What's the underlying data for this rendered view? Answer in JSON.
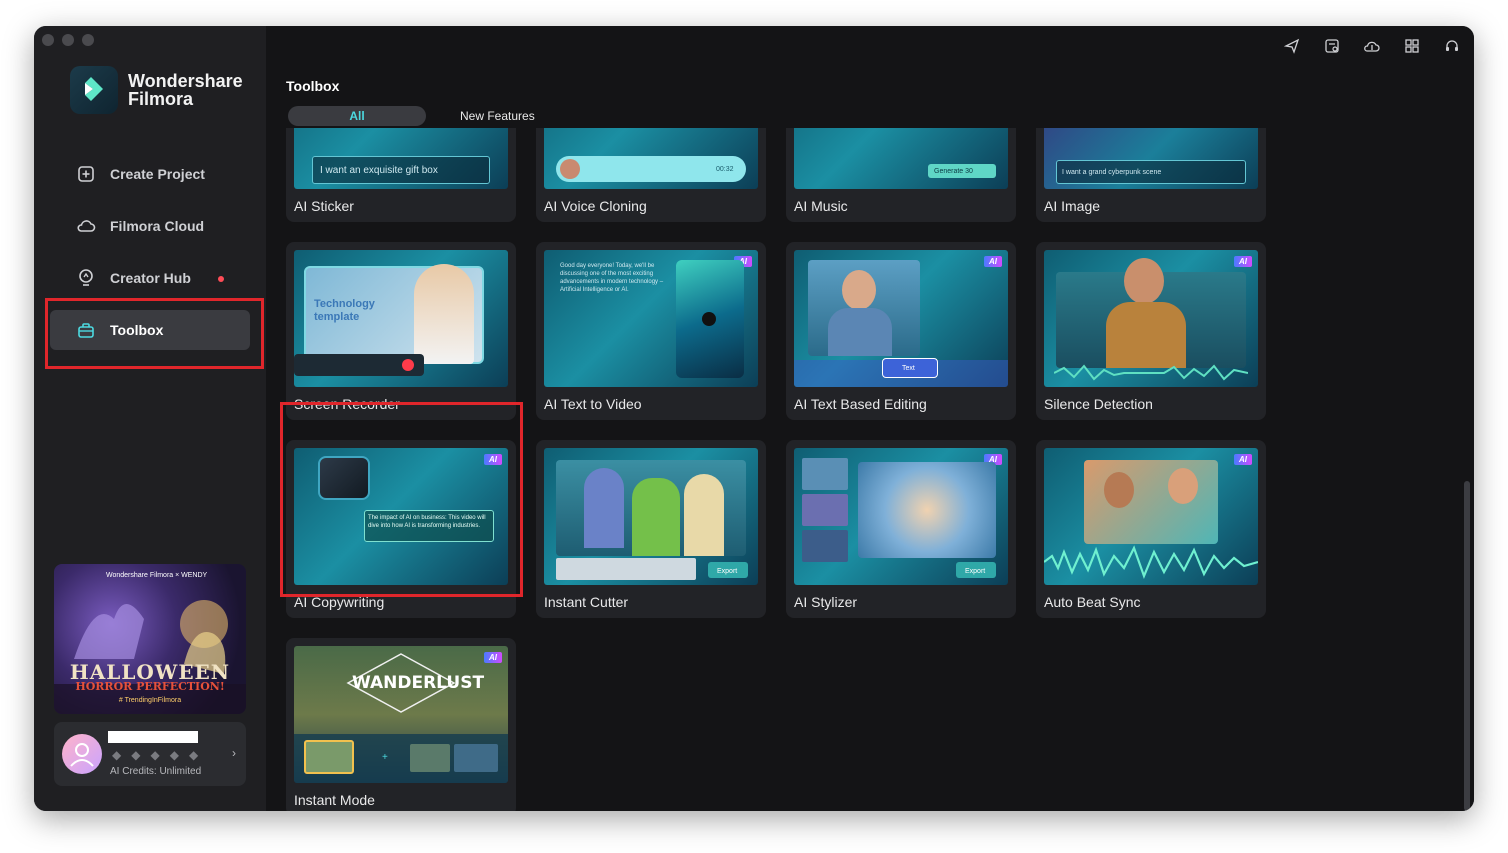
{
  "app": {
    "brand_line1": "Wondershare",
    "brand_line2": "Filmora"
  },
  "sidebar": {
    "items": [
      {
        "label": "Create Project",
        "icon": "plus-square-icon"
      },
      {
        "label": "Filmora Cloud",
        "icon": "cloud-icon"
      },
      {
        "label": "Creator Hub",
        "icon": "bulb-icon"
      },
      {
        "label": "Toolbox",
        "icon": "toolbox-icon"
      }
    ],
    "promo": {
      "brand_small": "Wondershare Filmora  ×  WENDY",
      "title_line1": "HALLOWEEN",
      "title_line2": "HORROR PERFECTION!",
      "hashtag": "# TrendingInFilmora"
    },
    "user": {
      "credits": "AI Credits: Unlimited"
    }
  },
  "main": {
    "title": "Toolbox",
    "tabs": [
      {
        "label": "All"
      },
      {
        "label": "New Features"
      }
    ]
  },
  "cards": [
    {
      "label": "AI Sticker",
      "thumb_text": "I want an exquisite gift box"
    },
    {
      "label": "AI Voice Cloning",
      "thumb_text": "00:32"
    },
    {
      "label": "AI Music",
      "thumb_text": "Generate  30"
    },
    {
      "label": "AI Image",
      "thumb_text": "I want a grand cyberpunk scene"
    },
    {
      "label": "Screen Recorder",
      "thumb_text": "Technology template"
    },
    {
      "label": "AI Text to Video",
      "thumb_text": "Good day everyone! Today, we'll be discussing one of the most exciting advancements in modern technology – Artificial Intelligence or AI."
    },
    {
      "label": "AI Text Based Editing",
      "thumb_text": "Text"
    },
    {
      "label": "Silence Detection",
      "thumb_text": ""
    },
    {
      "label": "AI Copywriting",
      "thumb_text": "The impact of AI on business: This video will dive into how AI is transforming industries."
    },
    {
      "label": "Instant Cutter",
      "thumb_text": "Export"
    },
    {
      "label": "AI Stylizer",
      "thumb_text": "Export"
    },
    {
      "label": "Auto Beat Sync",
      "thumb_text": ""
    },
    {
      "label": "Instant Mode",
      "thumb_text": "WANDERLUST"
    }
  ],
  "ai_badge_label": "AI",
  "colors": {
    "accent": "#4cd9e0",
    "highlight_red": "#e0262b",
    "notification_dot": "#ff4c57"
  }
}
